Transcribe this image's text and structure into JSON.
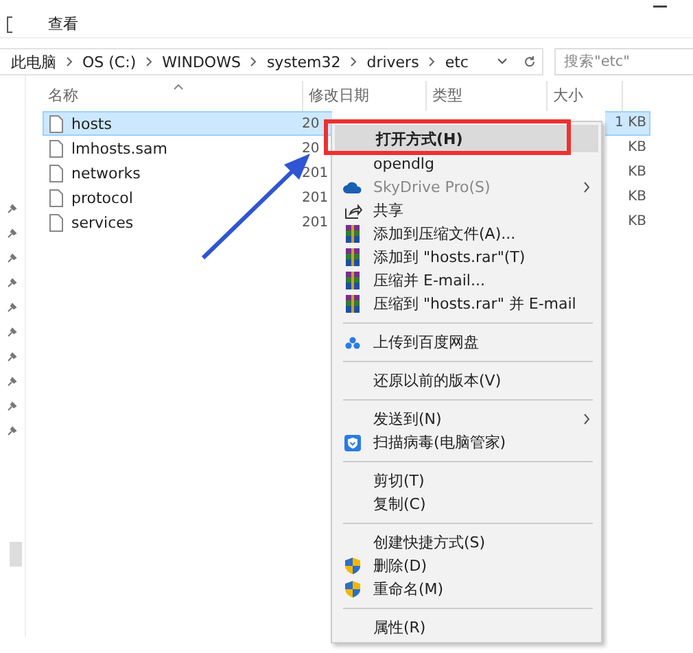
{
  "ribbon": {
    "tabs": [
      {
        "label": "查看",
        "selected": false
      }
    ]
  },
  "address_bar": {
    "crumbs": [
      "此电脑",
      "OS (C:)",
      "WINDOWS",
      "system32",
      "drivers",
      "etc"
    ]
  },
  "search": {
    "placeholder": "搜索\"etc\""
  },
  "file_list": {
    "columns": [
      "名称",
      "修改日期",
      "类型",
      "大小"
    ],
    "rows": [
      {
        "name": "hosts",
        "date": "20",
        "size": "1 KB",
        "selected": true
      },
      {
        "name": "lmhosts.sam",
        "date": "20",
        "size": "KB",
        "selected": false
      },
      {
        "name": "networks",
        "date": "201",
        "size": "KB",
        "selected": false
      },
      {
        "name": "protocol",
        "date": "201",
        "size": "KB",
        "selected": false
      },
      {
        "name": "services",
        "date": "201",
        "size": "KB",
        "selected": false
      }
    ]
  },
  "context_menu": {
    "items": [
      {
        "kind": "plain",
        "label": "打开方式(H)",
        "highlighted": true,
        "disabled": false,
        "submenu": false
      },
      {
        "kind": "plain",
        "label": "opendlg",
        "highlighted": false,
        "disabled": false,
        "submenu": false
      },
      {
        "kind": "cloud",
        "label": "SkyDrive Pro(S)",
        "highlighted": false,
        "disabled": true,
        "submenu": true
      },
      {
        "kind": "share",
        "label": "共享",
        "highlighted": false,
        "disabled": false,
        "submenu": false
      },
      {
        "kind": "archive",
        "label": "添加到压缩文件(A)...",
        "highlighted": false,
        "disabled": false,
        "submenu": false
      },
      {
        "kind": "archive",
        "label": "添加到 \"hosts.rar\"(T)",
        "highlighted": false,
        "disabled": false,
        "submenu": false
      },
      {
        "kind": "archive",
        "label": "压缩并 E-mail...",
        "highlighted": false,
        "disabled": false,
        "submenu": false
      },
      {
        "kind": "archive",
        "label": "压缩到 \"hosts.rar\" 并 E-mail",
        "highlighted": false,
        "disabled": false,
        "submenu": false
      },
      {
        "kind": "separator"
      },
      {
        "kind": "dots",
        "label": "上传到百度网盘",
        "highlighted": false,
        "disabled": false,
        "submenu": false
      },
      {
        "kind": "separator"
      },
      {
        "kind": "plain",
        "label": "还原以前的版本(V)",
        "highlighted": false,
        "disabled": false,
        "submenu": false
      },
      {
        "kind": "separator"
      },
      {
        "kind": "plain",
        "label": "发送到(N)",
        "highlighted": false,
        "disabled": false,
        "submenu": true
      },
      {
        "kind": "guard",
        "label": "扫描病毒(电脑管家)",
        "highlighted": false,
        "disabled": false,
        "submenu": false
      },
      {
        "kind": "separator"
      },
      {
        "kind": "plain",
        "label": "剪切(T)",
        "highlighted": false,
        "disabled": false,
        "submenu": false
      },
      {
        "kind": "plain",
        "label": "复制(C)",
        "highlighted": false,
        "disabled": false,
        "submenu": false
      },
      {
        "kind": "separator"
      },
      {
        "kind": "plain",
        "label": "创建快捷方式(S)",
        "highlighted": false,
        "disabled": false,
        "submenu": false
      },
      {
        "kind": "shield",
        "label": "删除(D)",
        "highlighted": false,
        "disabled": false,
        "submenu": false
      },
      {
        "kind": "shield",
        "label": "重命名(M)",
        "highlighted": false,
        "disabled": false,
        "submenu": false
      },
      {
        "kind": "separator"
      },
      {
        "kind": "plain",
        "label": "属性(R)",
        "highlighted": false,
        "disabled": false,
        "submenu": false
      }
    ]
  }
}
